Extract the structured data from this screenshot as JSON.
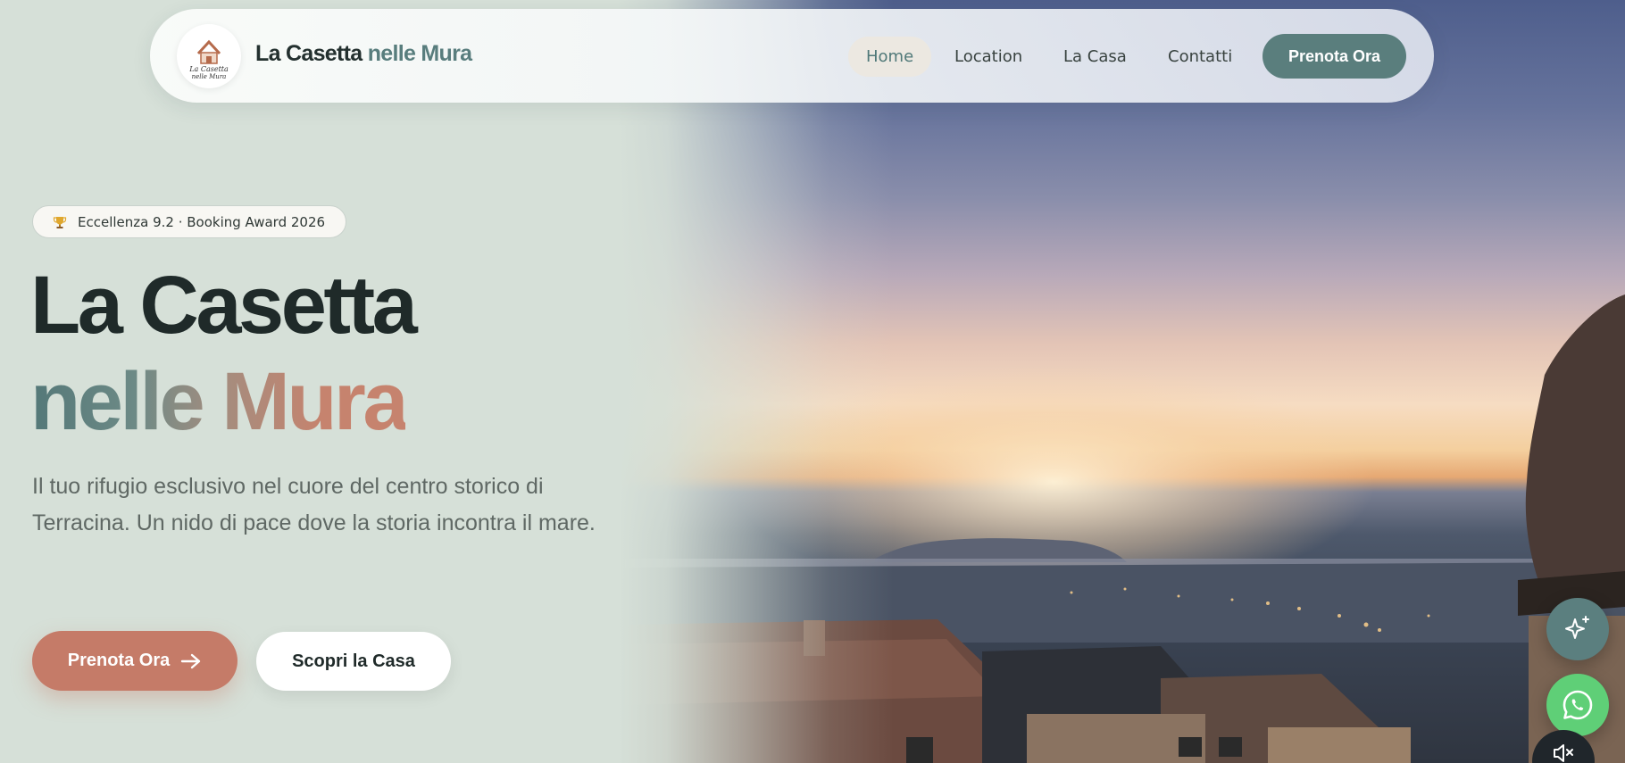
{
  "navbar": {
    "brand": {
      "name_part1": "La Casetta",
      "name_part2": "nelle Mura"
    },
    "logo": {
      "icon": "house-icon",
      "line1": "La Casetta",
      "line2": "nelle Mura"
    },
    "links": [
      {
        "label": "Home",
        "active": true
      },
      {
        "label": "Location",
        "active": false
      },
      {
        "label": "La Casa",
        "active": false
      },
      {
        "label": "Contatti",
        "active": false
      }
    ],
    "cta_label": "Prenota Ora"
  },
  "hero": {
    "badge": {
      "icon": "trophy-icon",
      "text": "Eccellenza 9.2 · Booking Award 2026"
    },
    "title": "La Casetta",
    "subtitle": "nelle Mura",
    "description": "Il tuo rifugio esclusivo nel cuore del centro storico di Terracina. Un nido di pace dove la storia incontra il mare.",
    "primary_button": "Prenota Ora",
    "secondary_button": "Scopri la Casa"
  },
  "floating_buttons": [
    {
      "name": "ai-assistant-button",
      "icon": "sparkles-icon"
    },
    {
      "name": "whatsapp-button",
      "icon": "whatsapp-icon"
    },
    {
      "name": "mute-button",
      "icon": "speaker-muted-icon"
    }
  ],
  "colors": {
    "accent": "#5a7e7d",
    "terracotta": "#c57b68",
    "background": "#d6e0d8",
    "text_dark": "#1f2a29",
    "whatsapp": "#5fcf77"
  }
}
